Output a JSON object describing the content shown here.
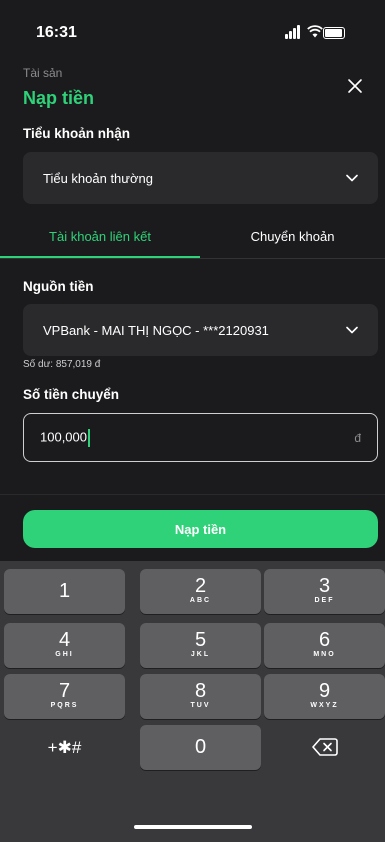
{
  "status_bar": {
    "time": "16:31"
  },
  "header": {
    "breadcrumb": "Tài sản",
    "title": "Nạp tiền"
  },
  "receive_account": {
    "label": "Tiểu khoản nhận",
    "value": "Tiểu khoản thường"
  },
  "tabs": [
    {
      "label": "Tài khoản liên kết",
      "active": true
    },
    {
      "label": "Chuyển khoản",
      "active": false
    }
  ],
  "source": {
    "label": "Nguồn tiền",
    "value": "VPBank - MAI THỊ NGỌC - ***2120931",
    "balance": "Số dư: 857,019 đ"
  },
  "amount": {
    "label": "Số tiền chuyển",
    "value": "100,000",
    "currency": "đ"
  },
  "submit_label": "Nạp tiền",
  "keypad": {
    "keys": [
      {
        "num": "1",
        "letters": ""
      },
      {
        "num": "2",
        "letters": "ABC"
      },
      {
        "num": "3",
        "letters": "DEF"
      },
      {
        "num": "4",
        "letters": "GHI"
      },
      {
        "num": "5",
        "letters": "JKL"
      },
      {
        "num": "6",
        "letters": "MNO"
      },
      {
        "num": "7",
        "letters": "PQRS"
      },
      {
        "num": "8",
        "letters": "TUV"
      },
      {
        "num": "9",
        "letters": "WXYZ"
      }
    ],
    "symbols": "+✱#",
    "zero": "0"
  },
  "colors": {
    "accent": "#2fd279",
    "background": "#1b1b1d",
    "field": "#2a2a2d",
    "keyboard": "#39393c",
    "key": "#5f5f62"
  }
}
